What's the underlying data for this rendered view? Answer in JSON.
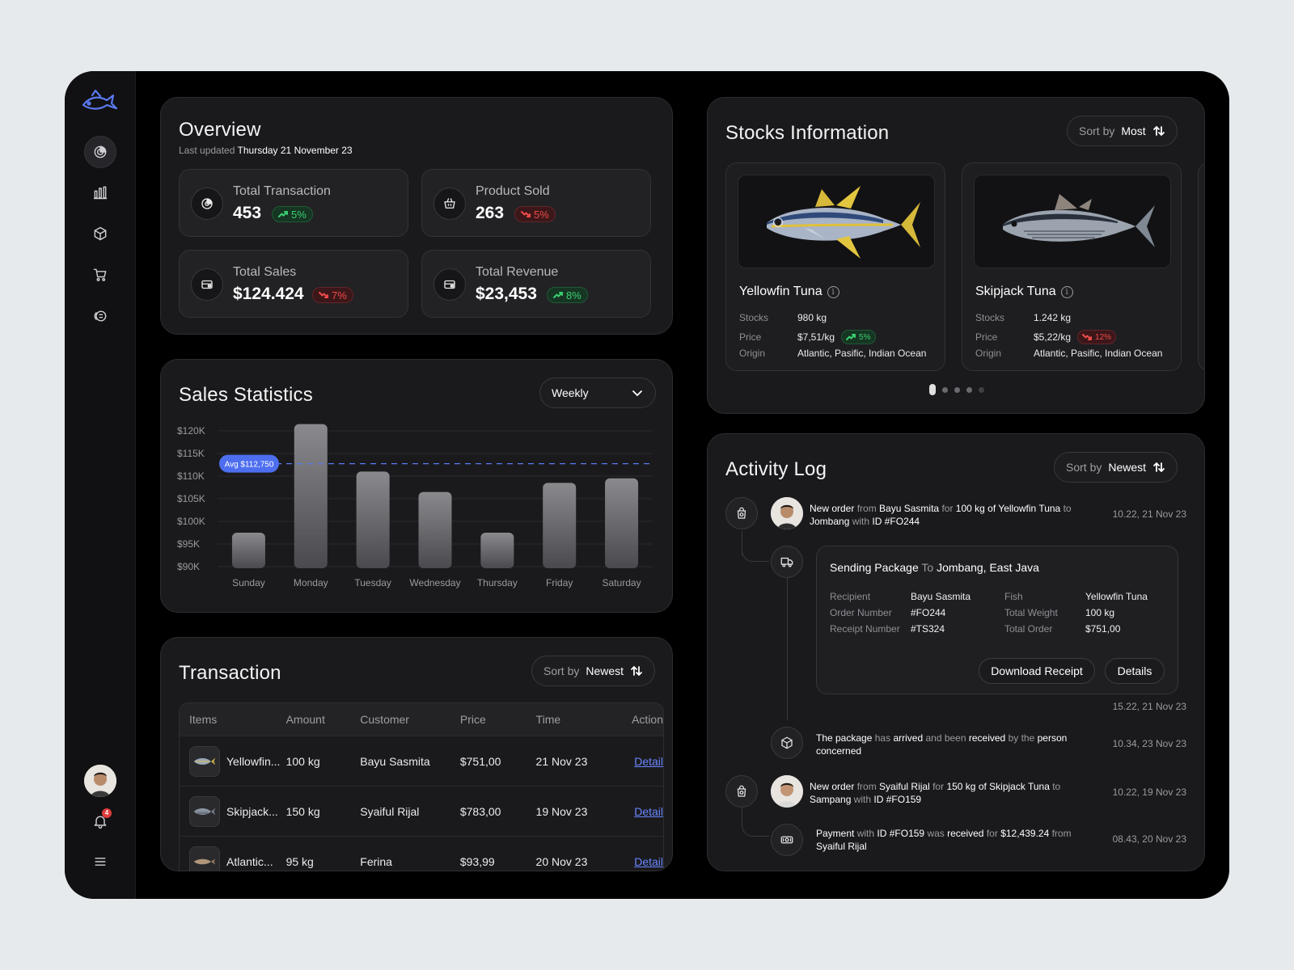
{
  "colors": {
    "accent": "#5b79f0",
    "up": "#3ccf73",
    "down": "#ee4b4b",
    "panel": "#1a1a1d"
  },
  "sidebar": {
    "logo_icon": "fish-logo-icon",
    "items": [
      {
        "icon": "dashboard-icon",
        "active": true
      },
      {
        "icon": "chart-icon"
      },
      {
        "icon": "box-icon"
      },
      {
        "icon": "cart-icon"
      },
      {
        "icon": "wallet-icon"
      }
    ],
    "notification_count": "4",
    "menu_icon": "hamburger-icon"
  },
  "overview": {
    "title": "Overview",
    "updated_prefix": "Last updated",
    "updated_value": "Thursday 21 November 23",
    "cards": [
      {
        "label": "Total Transaction",
        "value": "453",
        "change": "5%",
        "trend": "up",
        "icon": "target-icon"
      },
      {
        "label": "Product Sold",
        "value": "263",
        "change": "5%",
        "trend": "down",
        "icon": "basket-icon"
      },
      {
        "label": "Total Sales",
        "value": "$124.424",
        "change": "7%",
        "trend": "down",
        "icon": "cash-icon"
      },
      {
        "label": "Total Revenue",
        "value": "$23,453",
        "change": "8%",
        "trend": "up",
        "icon": "cash-icon"
      }
    ]
  },
  "sales": {
    "title": "Sales Statistics",
    "period": "Weekly",
    "avg_label": "Avg $112,750"
  },
  "chart_data": {
    "type": "bar",
    "categories": [
      "Sunday",
      "Monday",
      "Tuesday",
      "Wednesday",
      "Thursday",
      "Friday",
      "Saturday"
    ],
    "values": [
      97500,
      121500,
      111000,
      106500,
      97500,
      108500,
      109500
    ],
    "yticks": [
      "$120K",
      "$115K",
      "$110K",
      "$105K",
      "$100K",
      "$95K",
      "$90K"
    ],
    "ylim": [
      90000,
      120000
    ],
    "average": 112750,
    "title": "Sales Statistics",
    "xlabel": "",
    "ylabel": ""
  },
  "transaction": {
    "title": "Transaction",
    "sort_prefix": "Sort by",
    "sort_value": "Newest",
    "columns": [
      "Items",
      "Amount",
      "Customer",
      "Price",
      "Time",
      "Action"
    ],
    "rows": [
      {
        "item": "Yellowfin...",
        "amount": "100 kg",
        "customer": "Bayu Sasmita",
        "price": "$751,00",
        "time": "21 Nov 23",
        "action": "Detail"
      },
      {
        "item": "Skipjack...",
        "amount": "150 kg",
        "customer": "Syaiful Rijal",
        "price": "$783,00",
        "time": "19 Nov 23",
        "action": "Detail"
      },
      {
        "item": "Atlantic...",
        "amount": "95 kg",
        "customer": "Ferina",
        "price": "$93,99",
        "time": "20 Nov 23",
        "action": "Detail"
      }
    ]
  },
  "stocks": {
    "title": "Stocks Information",
    "sort_prefix": "Sort by",
    "sort_value": "Most",
    "labels": {
      "stocks": "Stocks",
      "price": "Price",
      "origin": "Origin"
    },
    "items": [
      {
        "name": "Yellowfin Tuna",
        "stocks": "980 kg",
        "price": "$7,51/kg",
        "change": "5%",
        "trend": "up",
        "origin": "Atlantic, Pasific, Indian Ocean"
      },
      {
        "name": "Skipjack Tuna",
        "stocks": "1.242 kg",
        "price": "$5,22/kg",
        "change": "12%",
        "trend": "down",
        "origin": "Atlantic, Pasific, Indian Ocean"
      }
    ]
  },
  "activity": {
    "title": "Activity Log",
    "sort_prefix": "Sort by",
    "sort_value": "Newest",
    "e1": {
      "a": "New order",
      "b": "from",
      "c": "Bayu Sasmita",
      "d": "for",
      "e": "100 kg of Yellowfin Tuna",
      "f": "to",
      "g": "Jombang",
      "h": "with",
      "i": "ID #FO244",
      "time": "10.22, 21 Nov 23"
    },
    "pkg": {
      "title_a": "Sending Package",
      "title_b": "To",
      "title_c": "Jombang, East Java",
      "recipient_k": "Recipient",
      "recipient_v": "Bayu Sasmita",
      "order_k": "Order Number",
      "order_v": "#FO244",
      "receipt_k": "Receipt Number",
      "receipt_v": "#TS324",
      "fish_k": "Fish",
      "fish_v": "Yellowfin Tuna",
      "weight_k": "Total Weight",
      "weight_v": "100 kg",
      "total_k": "Total Order",
      "total_v": "$751,00",
      "download": "Download Receipt",
      "details": "Details",
      "time": "15.22, 21 Nov 23"
    },
    "e2": {
      "a": "The package",
      "b": "has",
      "c": "arrived",
      "d": "and been",
      "e": "received",
      "f": "by the",
      "g": "person",
      "h": "concerned",
      "time": "10.34, 23 Nov 23"
    },
    "e3": {
      "a": "New order",
      "b": "from",
      "c": "Syaiful Rijal",
      "d": "for",
      "e": "150 kg of Skipjack Tuna",
      "f": "to",
      "g": "Sampang",
      "h": "with",
      "i": "ID #FO159",
      "time": "10.22, 19 Nov 23"
    },
    "e4": {
      "a": "Payment",
      "b": "with",
      "c": "ID #FO159",
      "d": "was",
      "e": "received",
      "f": "for",
      "g": "$12,439.24",
      "h": "from",
      "i": "Syaiful Rijal",
      "time": "08.43, 20 Nov 23"
    }
  }
}
